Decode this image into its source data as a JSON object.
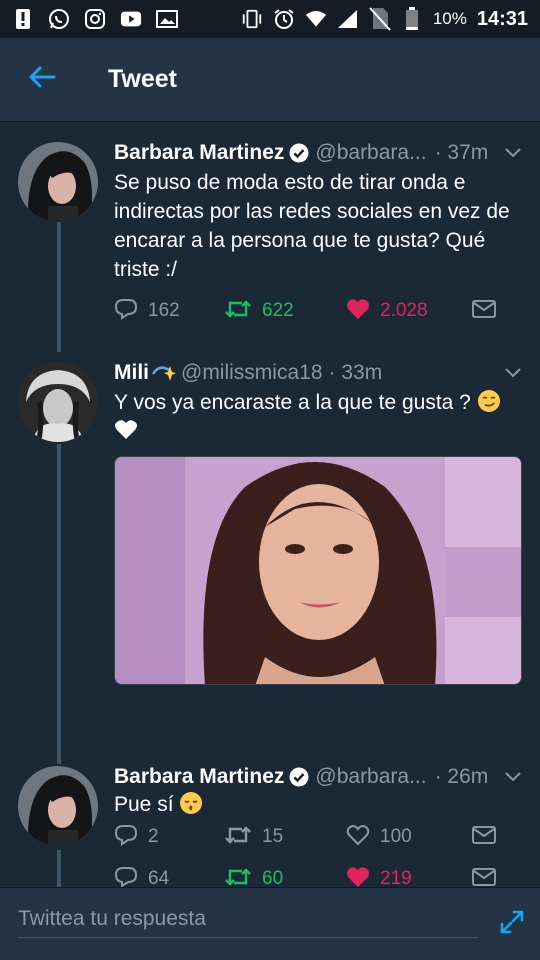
{
  "status_bar": {
    "battery": "10%",
    "time": "14:31"
  },
  "header": {
    "title": "Tweet"
  },
  "tweets": [
    {
      "name": "Barbara Martinez",
      "handle": "@barbara...",
      "time": "· 37m",
      "text": "Se puso de moda esto de tirar onda e indirectas por las redes sociales en vez de encarar a la persona que te gusta? Qué triste :/",
      "replies": "162",
      "retweets": "622",
      "likes": "2.028",
      "retweeted": true,
      "liked": true
    },
    {
      "name": "Mili",
      "handle": "@milissmica18",
      "time": "· 33m",
      "text": "Y vos ya encaraste a la que te gusta ?",
      "replies": "2",
      "retweets": "15",
      "likes": "100",
      "retweeted": false,
      "liked": false
    },
    {
      "name": "Barbara Martinez",
      "handle": "@barbara...",
      "time": "· 26m",
      "text": "Pue sí",
      "replies": "64",
      "retweets": "60",
      "likes": "219",
      "retweeted": true,
      "liked": true
    }
  ],
  "reply_bar": {
    "placeholder": "Twittea tu respuesta"
  },
  "colors": {
    "background": "#1b2836",
    "header": "#243447",
    "accent": "#1da1f2",
    "retweet_green": "#17bf63",
    "like_red": "#e0245e",
    "muted": "#8899a6"
  }
}
